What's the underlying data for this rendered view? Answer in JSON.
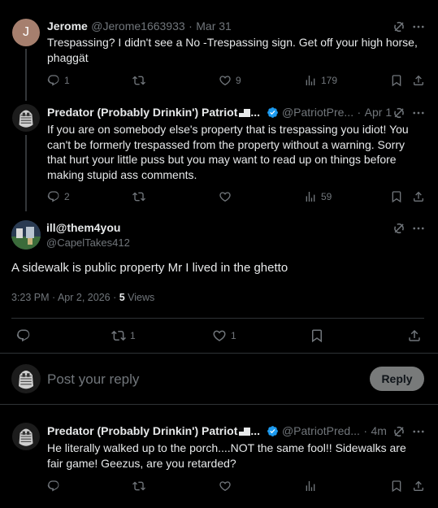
{
  "tweets": [
    {
      "name": "Jerome",
      "handle": "@Jerome1663933",
      "dot": "·",
      "time": "Mar 31",
      "avatar_letter": "J",
      "avatar_color": "#a67f6e",
      "text": "Trespassing? I didn't see a No -Trespassing sign. Get off your high horse, phaggät",
      "replies": "1",
      "retweets": "",
      "likes": "9",
      "views": "179"
    },
    {
      "name": "Predator (Probably Drinkin') Patriot",
      "ellipsis": "...",
      "handle": "@PatriotPre...",
      "dot": "·",
      "time": "Apr 1",
      "text": "If you are on somebody else's property that is trespassing you idiot! You can't be formerly trespassed from the property without a warning. Sorry that hurt your little puss but you may want to read up on things before making stupid ass comments.",
      "replies": "2",
      "retweets": "",
      "likes": "",
      "views": "59"
    }
  ],
  "main_tweet": {
    "name": "ill@them4you",
    "handle": "@CapelTakes412",
    "text": "A sidewalk is public property Mr I lived in the ghetto",
    "timestamp": "3:23 PM · Apr 2, 2026 · ",
    "views_count": "5",
    "views_label": " Views",
    "replies": "",
    "retweets": "1",
    "likes": "1"
  },
  "composer": {
    "placeholder": "Post your reply",
    "reply_button": "Reply"
  },
  "reply": {
    "name": "Predator (Probably Drinkin') Patriot",
    "ellipsis": "...",
    "handle": "@PatriotPred...",
    "dot": "·",
    "time": "4m",
    "text": "He literally walked up to the porch....NOT the same fool!! Sidewalks are fair game! Geezus, are you retarded?"
  },
  "colors": {
    "background": "#000000",
    "text": "#e7e9ea",
    "muted": "#71767b",
    "verified": "#1d9bf0",
    "divider": "#2f3336"
  },
  "icons": [
    "grok-icon",
    "more-icon",
    "reply-icon",
    "retweet-icon",
    "like-icon",
    "views-icon",
    "bookmark-icon",
    "share-icon",
    "verified-badge-icon"
  ]
}
